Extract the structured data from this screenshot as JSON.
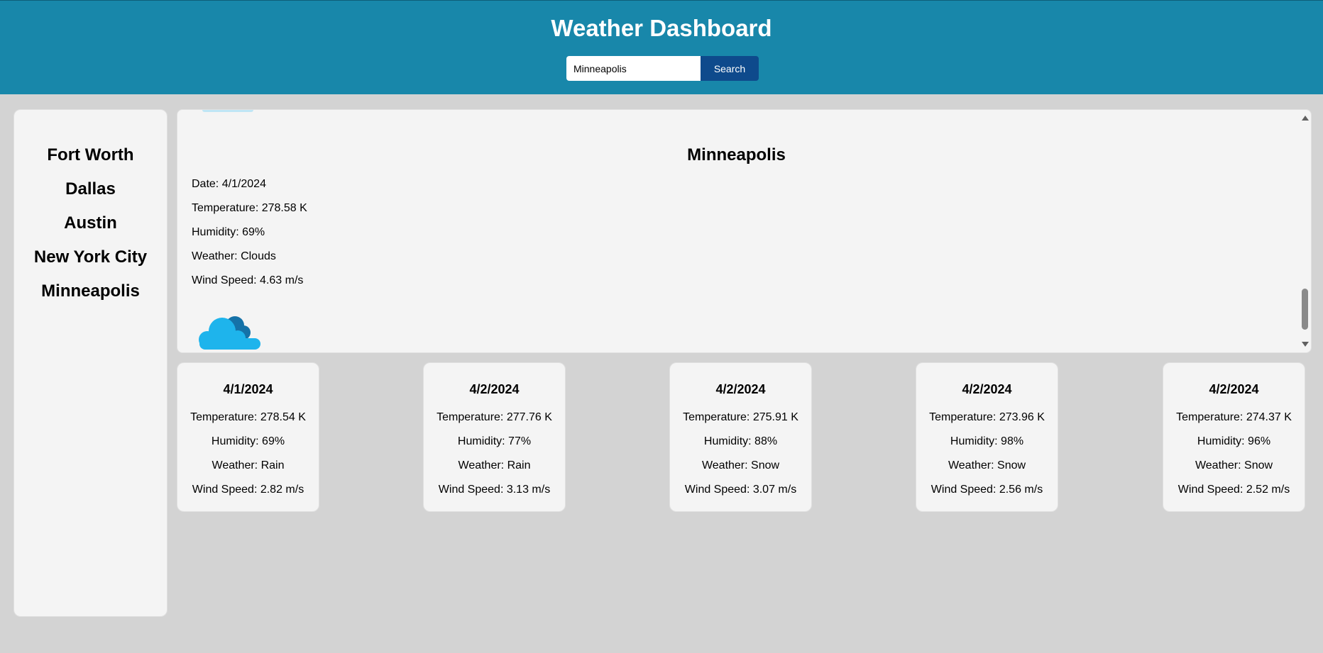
{
  "app": {
    "title": "Weather Dashboard"
  },
  "search": {
    "value": "Minneapolis",
    "button_label": "Search"
  },
  "sidebar": {
    "cities": [
      "Fort Worth",
      "Dallas",
      "Austin",
      "New York City",
      "Minneapolis"
    ]
  },
  "current": {
    "city": "Minneapolis",
    "date": "Date: 4/1/2024",
    "temperature": "Temperature: 278.58 K",
    "humidity": "Humidity: 69%",
    "weather": "Weather: Clouds",
    "wind": "Wind Speed: 4.63 m/s",
    "icon": "clouds-icon"
  },
  "forecast": [
    {
      "date": "4/1/2024",
      "temperature": "Temperature: 278.54 K",
      "humidity": "Humidity: 69%",
      "weather": "Weather: Rain",
      "wind": "Wind Speed: 2.82 m/s"
    },
    {
      "date": "4/2/2024",
      "temperature": "Temperature: 277.76 K",
      "humidity": "Humidity: 77%",
      "weather": "Weather: Rain",
      "wind": "Wind Speed: 3.13 m/s"
    },
    {
      "date": "4/2/2024",
      "temperature": "Temperature: 275.91 K",
      "humidity": "Humidity: 88%",
      "weather": "Weather: Snow",
      "wind": "Wind Speed: 3.07 m/s"
    },
    {
      "date": "4/2/2024",
      "temperature": "Temperature: 273.96 K",
      "humidity": "Humidity: 98%",
      "weather": "Weather: Snow",
      "wind": "Wind Speed: 2.56 m/s"
    },
    {
      "date": "4/2/2024",
      "temperature": "Temperature: 274.37 K",
      "humidity": "Humidity: 96%",
      "weather": "Weather: Snow",
      "wind": "Wind Speed: 2.52 m/s"
    }
  ],
  "colors": {
    "header": "#1887aa",
    "search_button": "#0e4a8c",
    "background": "#d3d3d3",
    "card": "#f4f4f4",
    "cloud_front": "#1eb4ec",
    "cloud_back": "#1572a8"
  }
}
